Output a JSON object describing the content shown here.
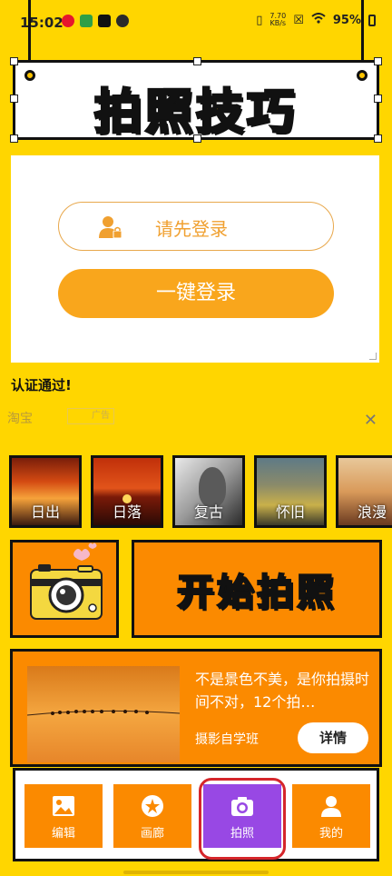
{
  "status_bar": {
    "time": "15:02",
    "net_speed_value": "7.70",
    "net_speed_unit": "KB/s",
    "battery": "95%"
  },
  "header": {
    "title": "拍照技巧"
  },
  "login": {
    "placeholder": "请先登录",
    "button_label": "一键登录"
  },
  "verified_text": "认证通过!",
  "ad": {
    "source": "淘宝",
    "tag": "广告"
  },
  "filters": [
    {
      "label": "日出"
    },
    {
      "label": "日落"
    },
    {
      "label": "复古"
    },
    {
      "label": "怀旧"
    },
    {
      "label": "浪漫"
    }
  ],
  "start_label": "开始拍照",
  "article": {
    "headline": "不是景色不美，是你拍摄时间不对，12个拍…",
    "source": "摄影自学班",
    "detail_label": "详情"
  },
  "nav": {
    "items": [
      {
        "label": "编辑",
        "icon": "image-icon"
      },
      {
        "label": "画廊",
        "icon": "flower-icon"
      },
      {
        "label": "拍照",
        "icon": "camera-icon"
      },
      {
        "label": "我的",
        "icon": "user-icon"
      }
    ],
    "active_index": 2
  },
  "colors": {
    "background": "#FFD600",
    "accent_orange": "#FB8A00",
    "active_purple": "#9848E4",
    "highlight_red": "#D5262B"
  }
}
